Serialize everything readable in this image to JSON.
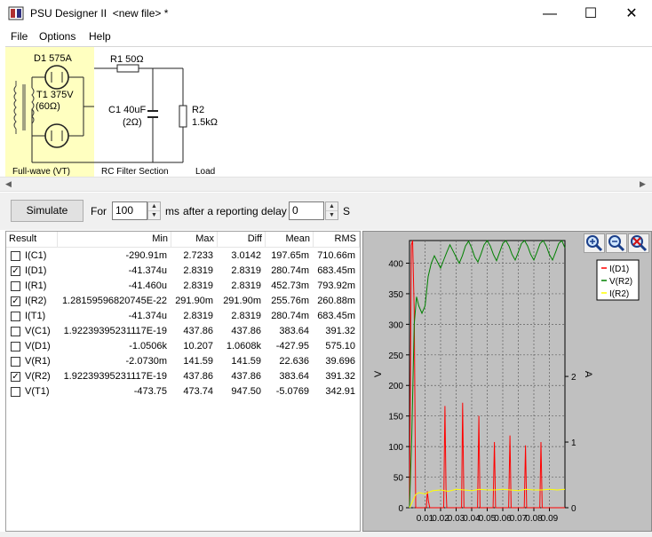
{
  "window": {
    "title": "PSU Designer II  <new file> *",
    "minimize_glyph": "—",
    "maximize_glyph": "☐",
    "close_glyph": "✕"
  },
  "menu": [
    "File",
    "Options",
    "Help"
  ],
  "schematic": {
    "diode_label": "D1 575A",
    "transformer_label": "T1 375V",
    "transformer_res": "(60Ω)",
    "rect_label": "Full-wave (VT)",
    "r1_label": "R1 50Ω",
    "c1_label": "C1 40uF",
    "c1_res": "(2Ω)",
    "filter_label": "RC Filter Section",
    "r2_label": "R2",
    "r2_value": "1.5kΩ",
    "load_label": "Load"
  },
  "toolbar": {
    "simulate_label": "Simulate",
    "for_label": "For",
    "duration_value": "100",
    "ms_label": "ms",
    "after_label": "after a reporting delay of",
    "delay_value": "0",
    "s_label": "S"
  },
  "results": {
    "columns": [
      "Result",
      "Min",
      "Max",
      "Diff",
      "Mean",
      "RMS"
    ],
    "rows": [
      {
        "checked": false,
        "name": "I(C1)",
        "min": "-290.91m",
        "max": "2.7233",
        "diff": "3.0142",
        "mean": "197.65m",
        "rms": "710.66m"
      },
      {
        "checked": true,
        "name": "I(D1)",
        "min": "-41.374u",
        "max": "2.8319",
        "diff": "2.8319",
        "mean": "280.74m",
        "rms": "683.45m"
      },
      {
        "checked": false,
        "name": "I(R1)",
        "min": "-41.460u",
        "max": "2.8319",
        "diff": "2.8319",
        "mean": "452.73m",
        "rms": "793.92m"
      },
      {
        "checked": true,
        "name": "I(R2)",
        "min": "1.28159596820745E-22",
        "max": "291.90m",
        "diff": "291.90m",
        "mean": "255.76m",
        "rms": "260.88m"
      },
      {
        "checked": false,
        "name": "I(T1)",
        "min": "-41.374u",
        "max": "2.8319",
        "diff": "2.8319",
        "mean": "280.74m",
        "rms": "683.45m"
      },
      {
        "checked": false,
        "name": "V(C1)",
        "min": "1.92239395231117E-19",
        "max": "437.86",
        "diff": "437.86",
        "mean": "383.64",
        "rms": "391.32"
      },
      {
        "checked": false,
        "name": "V(D1)",
        "min": "-1.0506k",
        "max": "10.207",
        "diff": "1.0608k",
        "mean": "-427.95",
        "rms": "575.10"
      },
      {
        "checked": false,
        "name": "V(R1)",
        "min": "-2.0730m",
        "max": "141.59",
        "diff": "141.59",
        "mean": "22.636",
        "rms": "39.696"
      },
      {
        "checked": true,
        "name": "V(R2)",
        "min": "1.92239395231117E-19",
        "max": "437.86",
        "diff": "437.86",
        "mean": "383.64",
        "rms": "391.32"
      },
      {
        "checked": false,
        "name": "V(T1)",
        "min": "-473.75",
        "max": "473.74",
        "diff": "947.50",
        "mean": "-5.0769",
        "rms": "342.91"
      }
    ]
  },
  "chart_data": {
    "type": "line",
    "xlabel": "",
    "ylabel": "V",
    "ylabel_right": "A",
    "xlim": [
      0,
      0.1
    ],
    "ylim": [
      0,
      437
    ],
    "ylim_right": [
      0,
      4.07
    ],
    "x_ticks": [
      "0.01",
      "0.02",
      "0.03",
      "0.04",
      "0.05",
      "0.06",
      "0.07",
      "0.08",
      "0.09"
    ],
    "y_ticks_left": [
      "0",
      "50",
      "100",
      "150",
      "200",
      "250",
      "300",
      "350",
      "400"
    ],
    "y_ticks_right": [
      "0",
      "1",
      "2"
    ],
    "grid": true,
    "legend_position": "top-right",
    "series": [
      {
        "name": "I(D1)",
        "color": "#ff0000",
        "axis": "right",
        "x": [
          0,
          0.0012,
          0.002,
          0.003,
          0.004,
          0.006,
          0.008,
          0.0108,
          0.0115,
          0.0122,
          0.013,
          0.02,
          0.022,
          0.0228,
          0.0235,
          0.024,
          0.03,
          0.0335,
          0.0342,
          0.035,
          0.04,
          0.0438,
          0.0446,
          0.0454,
          0.05,
          0.0538,
          0.0546,
          0.0554,
          0.06,
          0.0638,
          0.0646,
          0.0654,
          0.07,
          0.0738,
          0.0746,
          0.0754,
          0.08,
          0.0838,
          0.0846,
          0.0854,
          0.09,
          0.1
        ],
        "y": [
          0,
          4.0,
          4.07,
          3.0,
          0,
          0,
          0,
          0,
          0.25,
          0.1,
          0,
          0,
          0,
          1.55,
          0.3,
          0,
          0,
          0,
          1.6,
          0,
          0,
          0,
          1.4,
          0,
          0,
          0,
          1.0,
          0,
          0,
          0,
          1.1,
          0,
          0,
          0,
          0.95,
          0,
          0,
          0,
          1.0,
          0,
          0,
          0
        ]
      },
      {
        "name": "V(R2)",
        "color": "#008000",
        "axis": "left",
        "x": [
          0,
          0.0015,
          0.003,
          0.0045,
          0.006,
          0.008,
          0.01,
          0.012,
          0.014,
          0.016,
          0.018,
          0.02,
          0.022,
          0.024,
          0.026,
          0.028,
          0.03,
          0.032,
          0.034,
          0.036,
          0.038,
          0.04,
          0.042,
          0.044,
          0.046,
          0.048,
          0.05,
          0.052,
          0.054,
          0.056,
          0.058,
          0.06,
          0.062,
          0.064,
          0.066,
          0.068,
          0.07,
          0.072,
          0.074,
          0.076,
          0.078,
          0.08,
          0.082,
          0.084,
          0.086,
          0.088,
          0.09,
          0.092,
          0.094,
          0.096,
          0.098,
          0.1
        ],
        "y": [
          0,
          120,
          300,
          345,
          330,
          318,
          330,
          378,
          400,
          412,
          402,
          392,
          405,
          418,
          430,
          420,
          410,
          400,
          412,
          428,
          436,
          425,
          410,
          402,
          415,
          430,
          437,
          428,
          414,
          404,
          418,
          432,
          437,
          428,
          414,
          405,
          418,
          432,
          437,
          428,
          414,
          405,
          418,
          432,
          437,
          428,
          414,
          405,
          418,
          432,
          437,
          425
        ]
      },
      {
        "name": "I(R2)",
        "color": "#ffff00",
        "axis": "right",
        "x": [
          0,
          0.002,
          0.004,
          0.006,
          0.008,
          0.01,
          0.015,
          0.02,
          0.025,
          0.03,
          0.035,
          0.04,
          0.045,
          0.05,
          0.055,
          0.06,
          0.065,
          0.07,
          0.075,
          0.08,
          0.085,
          0.09,
          0.095,
          0.1
        ],
        "y": [
          0,
          0.1,
          0.2,
          0.23,
          0.22,
          0.21,
          0.26,
          0.27,
          0.25,
          0.28,
          0.27,
          0.26,
          0.28,
          0.27,
          0.27,
          0.28,
          0.27,
          0.26,
          0.28,
          0.27,
          0.27,
          0.28,
          0.27,
          0.28
        ]
      }
    ]
  }
}
